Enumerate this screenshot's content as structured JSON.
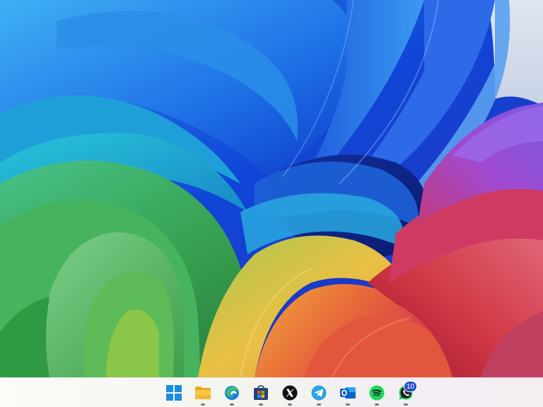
{
  "wallpaper": {
    "name": "windows-11-bloom-wallpaper",
    "colors": {
      "blue": "#1a5fe8",
      "cyan": "#29b4e0",
      "green": "#48b86a",
      "yellow": "#e8c040",
      "orange": "#e8803a",
      "red": "#d23a50",
      "purple": "#8d4ad8"
    }
  },
  "taskbar": {
    "background": "#f5f4f0",
    "items": [
      {
        "id": "start",
        "icon": "windows-start-icon",
        "running": false
      },
      {
        "id": "file-explorer",
        "icon": "file-explorer-icon",
        "running": true
      },
      {
        "id": "edge",
        "icon": "edge-browser-icon",
        "running": true
      },
      {
        "id": "store",
        "icon": "microsoft-store-icon",
        "running": true
      },
      {
        "id": "x",
        "icon": "x-app-icon",
        "running": true
      },
      {
        "id": "telegram",
        "icon": "telegram-icon",
        "running": true
      },
      {
        "id": "outlook",
        "icon": "outlook-icon",
        "running": true
      },
      {
        "id": "spotify",
        "icon": "spotify-icon",
        "running": true
      },
      {
        "id": "whatsapp",
        "icon": "whatsapp-icon",
        "running": true,
        "badge": "10"
      }
    ],
    "whatsapp_badge": "10"
  }
}
